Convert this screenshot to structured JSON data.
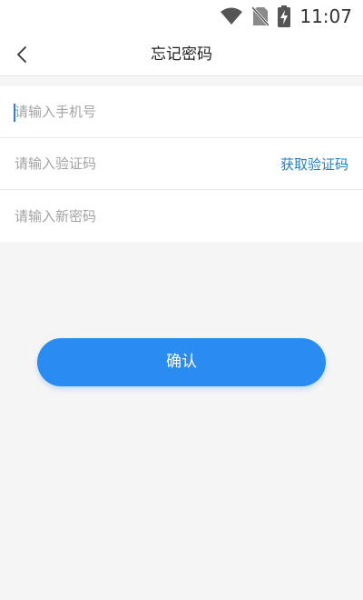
{
  "status_bar": {
    "time": "11:07",
    "icons": [
      "wifi-icon",
      "no-sim-icon",
      "battery-charging-icon"
    ]
  },
  "nav": {
    "title": "忘记密码",
    "back_icon": "chevron-left-icon"
  },
  "form": {
    "phone_placeholder": "请输入手机号",
    "code_placeholder": "请输入验证码",
    "get_code_label": "获取验证码",
    "new_password_placeholder": "请输入新密码"
  },
  "confirm_label": "确认",
  "colors": {
    "accent": "#2a8cf1",
    "link": "#1f7fc2",
    "background": "#f5f5f5"
  }
}
